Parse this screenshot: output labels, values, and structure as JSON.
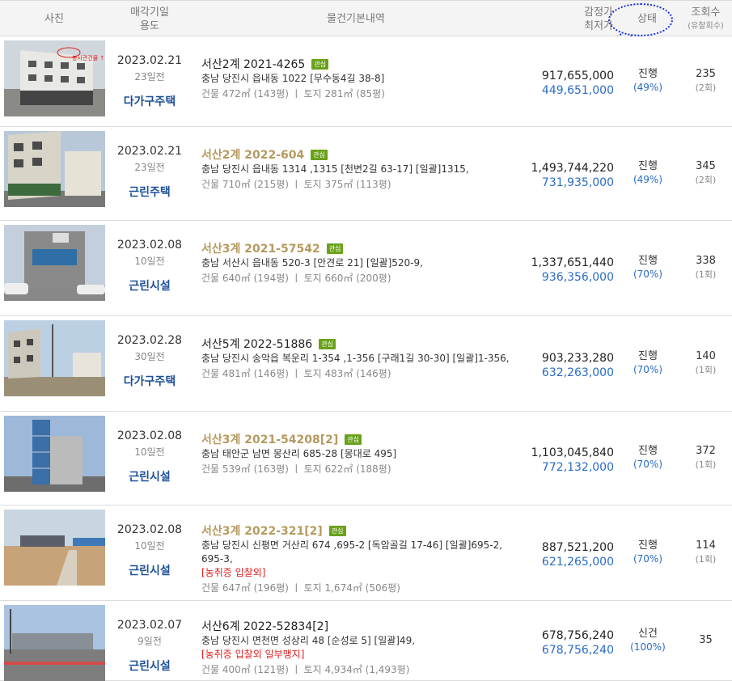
{
  "header": {
    "photo": "사진",
    "date_line1": "매각기일",
    "date_line2": "용도",
    "info": "물건기본내역",
    "price_line1": "감정가",
    "price_line2": "최저가",
    "status": "상태",
    "views_line1": "조회수",
    "views_line2": "(유찰회수)"
  },
  "annotation_color": "#1a2fd8",
  "photo_overlay_text": "봉사관건물 ↑",
  "rows": [
    {
      "date": "2023.02.21",
      "days": "23일전",
      "usage": "다가구주택",
      "case": "서산2계 2021-4265",
      "case_gold": false,
      "tag": "관심",
      "address": "충남 당진시 읍내동 1022 [무수동4길 38-8]",
      "warn": "",
      "area": "건물 472㎡ (143평)  ㅣ  토지 281㎡ (85평)",
      "appraisal": "917,655,000",
      "minimum": "449,651,000",
      "status": "진행",
      "pct": "(49%)",
      "views": "235",
      "fails": "(2회)"
    },
    {
      "date": "2023.02.21",
      "days": "23일전",
      "usage": "근린주택",
      "case": "서산2계 2022-604",
      "case_gold": true,
      "tag": "관심",
      "address": "충남 당진시 읍내동 1314 ,1315 [천변2길 63-17]  [일괄]1315,",
      "warn": "",
      "area": "건물 710㎡ (215평)  ㅣ  토지 375㎡ (113평)",
      "appraisal": "1,493,744,220",
      "minimum": "731,935,000",
      "status": "진행",
      "pct": "(49%)",
      "views": "345",
      "fails": "(2회)"
    },
    {
      "date": "2023.02.08",
      "days": "10일전",
      "usage": "근린시설",
      "case": "서산3계 2021-57542",
      "case_gold": true,
      "tag": "관심",
      "address": "충남 서산시 읍내동 520-3 [안견로 21]  [일괄]520-9,",
      "warn": "",
      "area": "건물 640㎡ (194평)  ㅣ  토지 660㎡ (200평)",
      "appraisal": "1,337,651,440",
      "minimum": "936,356,000",
      "status": "진행",
      "pct": "(70%)",
      "views": "338",
      "fails": "(1회)"
    },
    {
      "date": "2023.02.28",
      "days": "30일전",
      "usage": "다가구주택",
      "case": "서산5계 2022-51886",
      "case_gold": false,
      "tag": "관심",
      "address": "충남 당진시 송악읍 복운리 1-354 ,1-356 [구래1길 30-30]  [일괄]1-356,",
      "warn": "",
      "area": "건물 481㎡ (146평)  ㅣ  토지 483㎡ (146평)",
      "appraisal": "903,233,280",
      "minimum": "632,263,000",
      "status": "진행",
      "pct": "(70%)",
      "views": "140",
      "fails": "(1회)"
    },
    {
      "date": "2023.02.08",
      "days": "10일전",
      "usage": "근린시설",
      "case": "서산3계 2021-54208[2]",
      "case_gold": true,
      "tag": "관심",
      "address": "충남 태안군 남면 몽산리 685-28 [몽대로 495]",
      "warn": "",
      "area": "건물 539㎡ (163평)  ㅣ  토지 622㎡ (188평)",
      "appraisal": "1,103,045,840",
      "minimum": "772,132,000",
      "status": "진행",
      "pct": "(70%)",
      "views": "372",
      "fails": "(1회)"
    },
    {
      "date": "2023.02.08",
      "days": "10일전",
      "usage": "근린시설",
      "case": "서산3계 2022-321[2]",
      "case_gold": true,
      "tag": "관심",
      "address": "충남 당진시 신평면 거산리 674 ,695-2 [독암골길 17-46]  [일괄]695-2, 695-3,",
      "warn": "[농취증   입찰외]",
      "area": "건물 647㎡ (196평)  ㅣ  토지 1,674㎡ (506평)",
      "appraisal": "887,521,200",
      "minimum": "621,265,000",
      "status": "진행",
      "pct": "(70%)",
      "views": "114",
      "fails": "(1회)"
    },
    {
      "date": "2023.02.07",
      "days": "9일전",
      "usage": "근린시설",
      "case": "서산6계 2022-52834[2]",
      "case_gold": false,
      "tag": "",
      "address": "충남 당진시 면천면 성상리 48 [순성로 5]  [일괄]49,",
      "warn": "[농취증   입찰외   일부맹지]",
      "area": "건물 400㎡ (121평)  ㅣ  토지 4,934㎡ (1,493평)",
      "appraisal": "678,756,240",
      "minimum": "678,756,240",
      "status": "신건",
      "pct": "(100%)",
      "views": "35",
      "fails": ""
    }
  ]
}
